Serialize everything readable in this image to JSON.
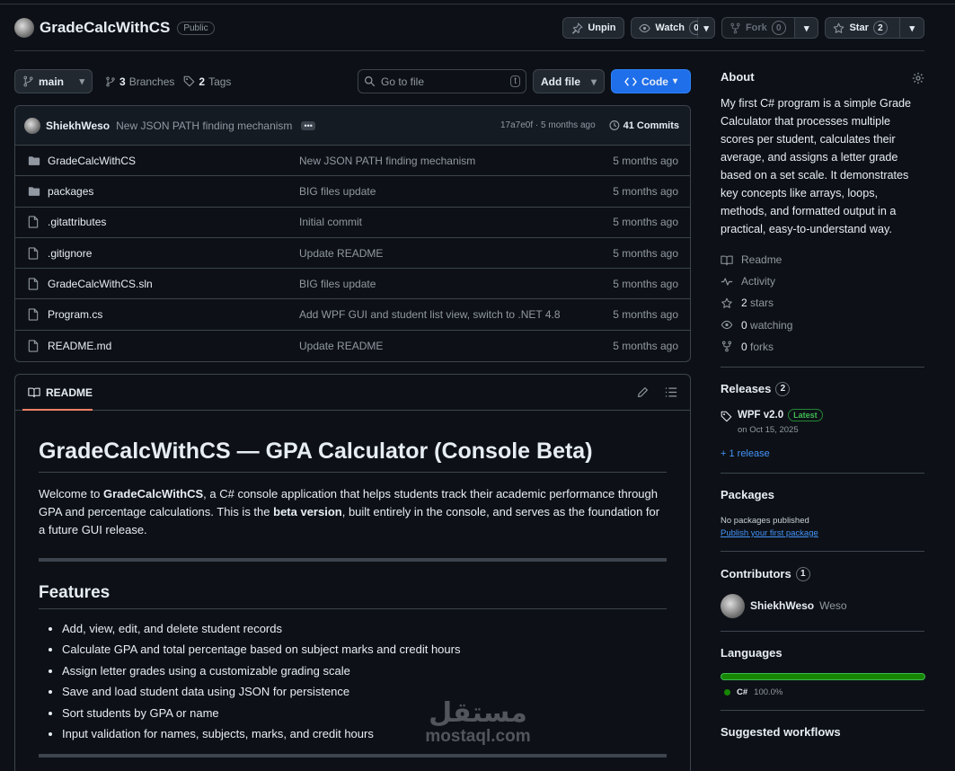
{
  "repo": {
    "name": "GradeCalcWithCS",
    "visibility": "Public",
    "unpin_label": "Unpin",
    "watch_label": "Watch",
    "watch_count": "0",
    "fork_label": "Fork",
    "fork_count": "0",
    "star_label": "Star",
    "star_count": "2"
  },
  "toolbar": {
    "branch": "main",
    "branches_count": "3",
    "branches_label": "Branches",
    "tags_count": "2",
    "tags_label": "Tags",
    "search_placeholder": "Go to file",
    "search_key": "t",
    "add_file_label": "Add file",
    "code_label": "Code"
  },
  "latest_commit": {
    "author": "ShiekhWeso",
    "message": "New JSON PATH finding mechanism",
    "ellipsis": "•••",
    "hash_time": "17a7e0f · 5 months ago",
    "commits_count": "41 Commits"
  },
  "files": [
    {
      "name": "GradeCalcWithCS",
      "type": "folder",
      "message": "New JSON PATH finding mechanism",
      "time": "5 months ago"
    },
    {
      "name": "packages",
      "type": "folder",
      "message": "BIG files update",
      "time": "5 months ago"
    },
    {
      "name": ".gitattributes",
      "type": "file",
      "message": "Initial commit",
      "time": "5 months ago"
    },
    {
      "name": ".gitignore",
      "type": "file",
      "message": "Update README",
      "time": "5 months ago"
    },
    {
      "name": "GradeCalcWithCS.sln",
      "type": "file",
      "message": "BIG files update",
      "time": "5 months ago"
    },
    {
      "name": "Program.cs",
      "type": "file",
      "message": "Add WPF GUI and student list view, switch to .NET 4.8",
      "time": "5 months ago"
    },
    {
      "name": "README.md",
      "type": "file",
      "message": "Update README",
      "time": "5 months ago"
    }
  ],
  "readme": {
    "tab_label": "README",
    "title": "GradeCalcWithCS — GPA Calculator (Console Beta)",
    "intro_1": "Welcome to ",
    "intro_bold_1": "GradeCalcWithCS",
    "intro_2": ", a C# console application that helps students track their academic performance through GPA and percentage calculations. This is the ",
    "intro_bold_2": "beta version",
    "intro_3": ", built entirely in the console, and serves as the foundation for a future GUI release.",
    "features_title": "Features",
    "features": [
      "Add, view, edit, and delete student records",
      "Calculate GPA and total percentage based on subject marks and credit hours",
      "Assign letter grades using a customizable grading scale",
      "Save and load student data using JSON for persistence",
      "Sort students by GPA or name",
      "Input validation for names, subjects, marks, and credit hours"
    ]
  },
  "about": {
    "title": "About",
    "description": "My first C# program is a simple Grade Calculator that processes multiple scores per student, calculates their average, and assigns a letter grade based on a set scale. It demonstrates key concepts like arrays, loops, methods, and formatted output in a practical, easy-to-understand way.",
    "readme": "Readme",
    "activity": "Activity",
    "stars_count": "2",
    "stars_label": "stars",
    "watching_count": "0",
    "watching_label": "watching",
    "forks_count": "0",
    "forks_label": "forks"
  },
  "releases": {
    "title": "Releases",
    "count": "2",
    "latest_name": "WPF v2.0",
    "latest_badge": "Latest",
    "latest_date": "on Oct 15, 2025",
    "more_link": "+ 1 release"
  },
  "packages": {
    "title": "Packages",
    "empty": "No packages published",
    "publish_link": "Publish your first package"
  },
  "contributors": {
    "title": "Contributors",
    "count": "1",
    "login": "ShiekhWeso",
    "name": "Weso"
  },
  "languages": {
    "title": "Languages",
    "items": [
      {
        "name": "C#",
        "percent": "100.0%",
        "color": "#178600",
        "share": 1.0
      }
    ]
  },
  "suggested": {
    "title": "Suggested workflows"
  },
  "watermark": {
    "logo": "مستقل",
    "site": "mostaql.com"
  },
  "colors": {
    "accent": "#1f6feb",
    "link": "#4493f8",
    "underline": "#f78166",
    "csharp": "#178600"
  }
}
